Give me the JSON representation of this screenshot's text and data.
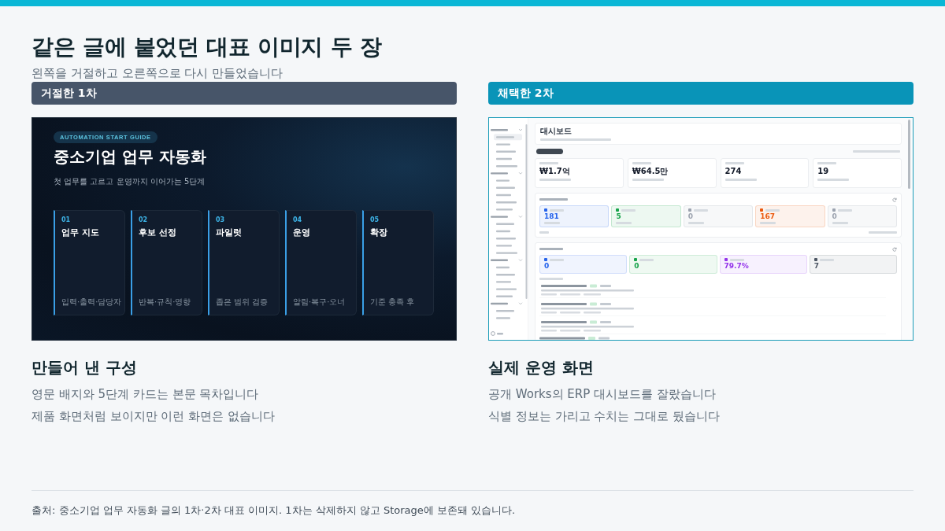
{
  "header": {
    "title": "같은 글에 붙었던 대표 이미지 두 장",
    "subtitle": "왼쪽을 거절하고 오른쪽으로 다시 만들었습니다"
  },
  "panels": [
    {
      "kind": "slide",
      "label": "거절한 1차",
      "slide": {
        "badge": "AUTOMATION START GUIDE",
        "title": "중소기업 업무 자동화",
        "subtitle": "첫 업무를 고르고 운영까지 이어가는 5단계",
        "cards": [
          {
            "number": "01",
            "title": "업무 지도",
            "note": "입력·출력·담당자"
          },
          {
            "number": "02",
            "title": "후보 선정",
            "note": "반복·규칙·영향"
          },
          {
            "number": "03",
            "title": "파일럿",
            "note": "좁은 범위 검증"
          },
          {
            "number": "04",
            "title": "운영",
            "note": "알림·복구·오너"
          },
          {
            "number": "05",
            "title": "확장",
            "note": "기준 충족 후"
          }
        ]
      },
      "heading": "만들어 낸 구성",
      "lines": [
        "영문 배지와 5단계 카드는 본문 목차입니다",
        "제품 화면처럼 보이지만 이런 화면은 없습니다"
      ]
    },
    {
      "kind": "dashboard",
      "label": "채택한 2차",
      "dashboard": {
        "title": "대시보드",
        "stat_cards": [
          {
            "value": "₩1.7억"
          },
          {
            "value": "₩64.5만"
          },
          {
            "value": "274"
          },
          {
            "value": "19"
          }
        ],
        "stock_tiles": [
          {
            "value": "181",
            "color": "#2563eb"
          },
          {
            "value": "5",
            "color": "#16a34a"
          },
          {
            "value": "0",
            "color": "#9ca3af"
          },
          {
            "value": "167",
            "color": "#ea580c"
          },
          {
            "value": "0",
            "color": "#9ca3af"
          }
        ],
        "lot_tiles": [
          {
            "value": "0",
            "color": "#2563eb"
          },
          {
            "value": "0",
            "color": "#16a34a"
          },
          {
            "value": "79.7%",
            "color": "#9333ea"
          },
          {
            "value": "7",
            "color": "#4b5563"
          }
        ]
      },
      "heading": "실제 운영 화면",
      "lines": [
        "공개 Works의 ERP 대시보드를 잘랐습니다",
        "식별 정보는 가리고 수치는 그대로 뒀습니다"
      ]
    }
  ],
  "footer": {
    "source": "출처: 중소기업 업무 자동화 글의 1차·2차 대표 이미지. 1차는 삭제하지 않고 Storage에 보존돼 있습니다."
  }
}
